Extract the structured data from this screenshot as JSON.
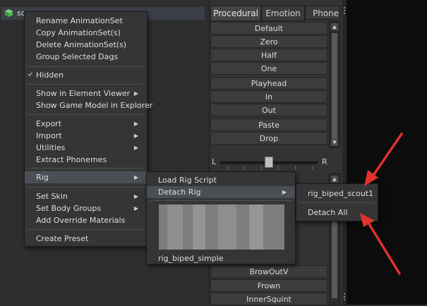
{
  "anim_set": {
    "label": "sc"
  },
  "tabs": [
    {
      "label": "Procedural",
      "active": true
    },
    {
      "label": "Emotion",
      "active": false
    },
    {
      "label": "Phoneme",
      "active": false
    }
  ],
  "procedural_buttons": [
    "Default",
    "Zero",
    "Half",
    "One",
    "Playhead",
    "In",
    "Out",
    "Paste",
    "Drop"
  ],
  "slider": {
    "left_label": "L",
    "right_label": "R"
  },
  "lower_buttons": [
    "BrowOutV",
    "Frown",
    "InnerSquint"
  ],
  "context_menu": {
    "items": [
      {
        "label": "Rename AnimationSet"
      },
      {
        "label": "Copy AnimationSet(s)"
      },
      {
        "label": "Delete AnimationSet(s)"
      },
      {
        "label": "Group Selected Dags"
      },
      {
        "label": "Hidden",
        "checked": true
      },
      {
        "label": "Show in Element Viewer",
        "submenu": true
      },
      {
        "label": "Show Game Model in Explorer"
      },
      {
        "label": "Export",
        "submenu": true
      },
      {
        "label": "Import",
        "submenu": true
      },
      {
        "label": "Utilities",
        "submenu": true
      },
      {
        "label": "Extract Phonemes"
      },
      {
        "label": "Rig",
        "submenu": true,
        "highlighted": true
      },
      {
        "label": "Set Skin",
        "submenu": true
      },
      {
        "label": "Set Body Groups",
        "submenu": true
      },
      {
        "label": "Add Override Materials"
      },
      {
        "label": "Create Preset"
      }
    ]
  },
  "rig_submenu": {
    "items": [
      {
        "label": "Load Rig Script"
      },
      {
        "label": "Detach Rig",
        "submenu": true,
        "highlighted": true
      },
      {
        "label": "rig_biped_simple"
      }
    ]
  },
  "detach_submenu": {
    "items": [
      {
        "label": "rig_biped_scout1"
      },
      {
        "label": "Detach All"
      }
    ]
  },
  "colors": {
    "annotation_arrow": "#e0322b",
    "highlight": "#4a4e55",
    "menu_bg": "#353535"
  }
}
